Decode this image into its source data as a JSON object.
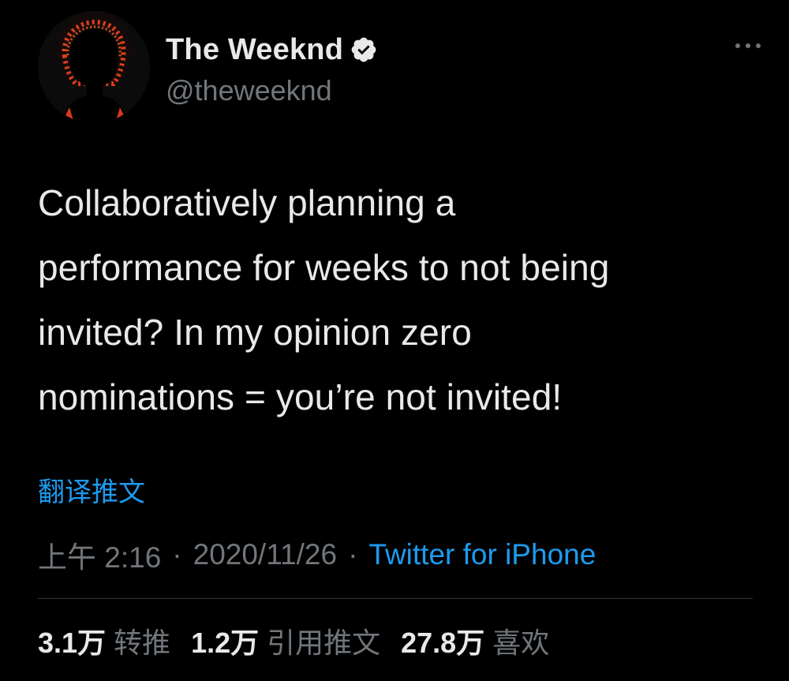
{
  "user": {
    "display_name": "The Weeknd",
    "handle": "@theweeknd",
    "verified": true
  },
  "tweet": {
    "text": "Collaboratively planning a\nperformance for weeks to not being\ninvited?  In my opinion zero\nnominations = you’re not invited!",
    "translate_label": "翻译推文",
    "time": "上午 2:16",
    "date": "2020/11/26",
    "separator": "·",
    "source": "Twitter for iPhone"
  },
  "stats": {
    "retweets_count": "3.1万",
    "retweets_label": "转推",
    "quotes_count": "1.2万",
    "quotes_label": "引用推文",
    "likes_count": "27.8万",
    "likes_label": "喜欢"
  },
  "icons": {
    "avatar": "avatar-silhouette",
    "verified": "verified-badge-icon",
    "more": "more-options-icon"
  },
  "colors": {
    "background": "#000000",
    "text_primary": "#e7e9ea",
    "text_secondary": "#71767b",
    "link": "#1d9bf0",
    "divider": "#2f3336"
  }
}
